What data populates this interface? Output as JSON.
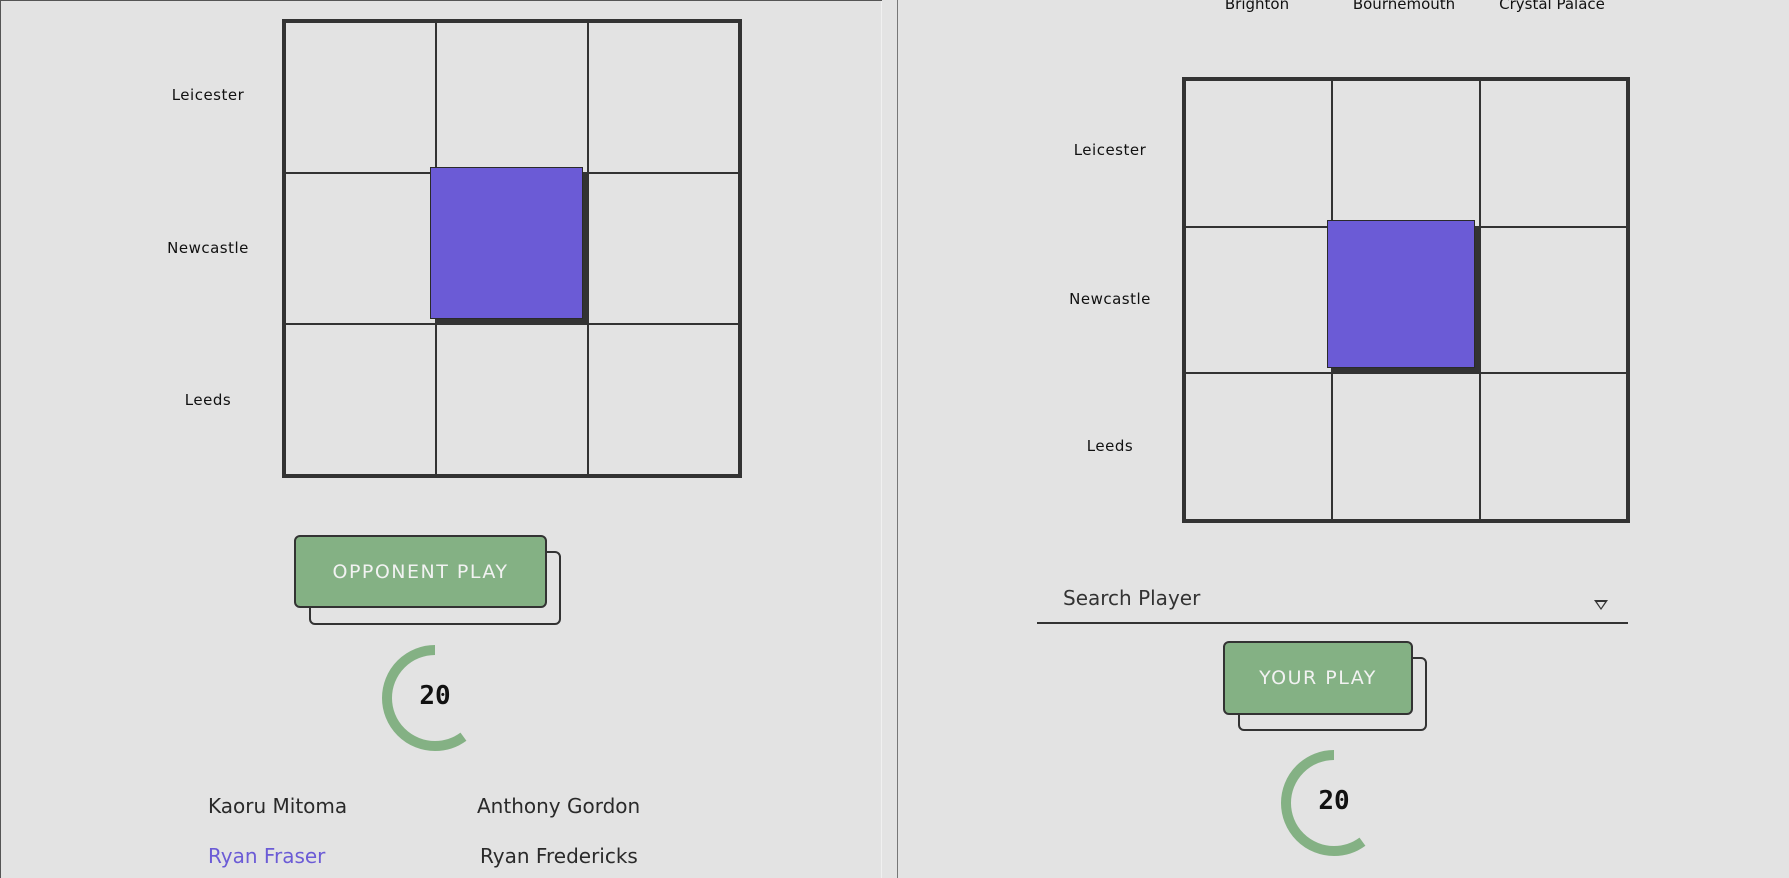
{
  "opponent_board": {
    "rows": [
      "Leicester",
      "Newcastle",
      "Leeds"
    ],
    "filled_cell": {
      "row": 1,
      "col": 1
    },
    "play_button": "OPPONENT PLAY",
    "timer": "20",
    "timer_fraction": 0.6,
    "players": [
      {
        "name": "Kaoru Mitoma",
        "highlight": false
      },
      {
        "name": "Anthony Gordon",
        "highlight": false
      },
      {
        "name": "Ryan Fraser",
        "highlight": true
      },
      {
        "name": "Ryan Fredericks",
        "highlight": false
      }
    ]
  },
  "my_board": {
    "columns": [
      "Brighton",
      "Bournemouth",
      "Crystal Palace"
    ],
    "rows": [
      "Leicester",
      "Newcastle",
      "Leeds"
    ],
    "filled_cell": {
      "row": 1,
      "col": 1
    },
    "search": {
      "placeholder": "Search Player",
      "value": ""
    },
    "play_button": "YOUR PLAY",
    "timer": "20",
    "timer_fraction": 0.6
  },
  "colors": {
    "accent": "#6b5bd6",
    "button": "#84b184",
    "timer_ring": "#84b184",
    "background": "#e3e3e3",
    "border": "#333333"
  }
}
